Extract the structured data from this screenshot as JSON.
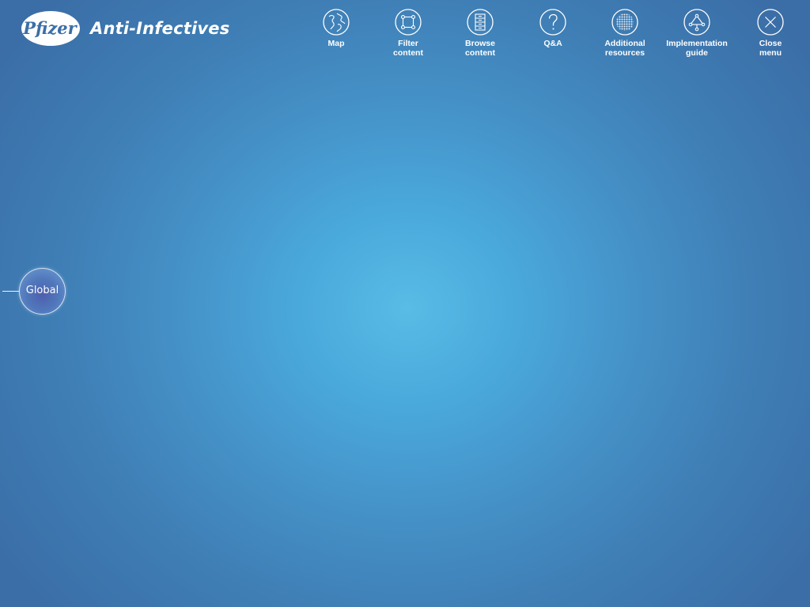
{
  "brand": {
    "logo_text": "Pfizer",
    "title": "Anti-Infectives"
  },
  "menu": [
    {
      "label": "Map",
      "icon": "globe-icon"
    },
    {
      "label": "Filter\ncontent",
      "icon": "filter-nodes-icon"
    },
    {
      "label": "Browse\ncontent",
      "icon": "file-cabinet-icon"
    },
    {
      "label": "Q&A",
      "icon": "question-mark-icon"
    },
    {
      "label": "Additional\nresources",
      "icon": "grid-pattern-icon"
    },
    {
      "label": "Implementation\nguide",
      "icon": "network-nodes-icon"
    },
    {
      "label": "Close\nmenu",
      "icon": "close-icon"
    }
  ],
  "map_nodes": {
    "global": {
      "label": "Global"
    }
  },
  "colors": {
    "background_center": "#58bce6",
    "background_edge": "#3b6ea7",
    "foreground": "#ffffff"
  }
}
